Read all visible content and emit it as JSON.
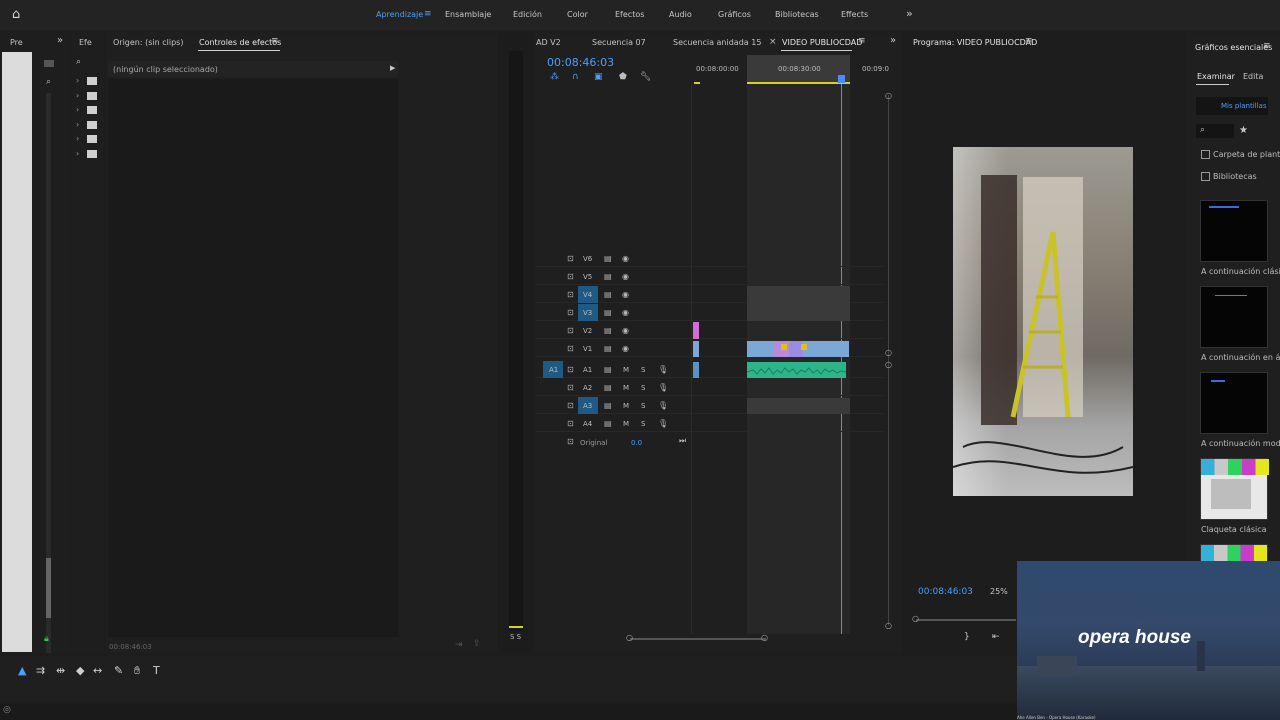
{
  "workspaces": [
    {
      "label": "Aprendizaje",
      "active": true
    },
    {
      "label": "Ensamblaje",
      "active": false
    },
    {
      "label": "Edición",
      "active": false
    },
    {
      "label": "Color",
      "active": false
    },
    {
      "label": "Efectos",
      "active": false
    },
    {
      "label": "Audio",
      "active": false
    },
    {
      "label": "Gráficos",
      "active": false
    },
    {
      "label": "Bibliotecas",
      "active": false
    },
    {
      "label": "Effects",
      "active": false
    }
  ],
  "panels": {
    "project_tab": "Pre",
    "effects_tab": "Efe",
    "source_tab": "Origen: (sin clips)",
    "effect_controls_tab": "Controles de efectos",
    "no_clip": "(ningún clip seleccionado)",
    "effect_controls_timecode": "00:08:46:03"
  },
  "timeline": {
    "tabs": [
      "AD V2",
      "Secuencia 07",
      "Secuencia anidada 15",
      "VIDEO PUBLIOCDAD"
    ],
    "active_tab": "VIDEO PUBLIOCDAD",
    "close_mark": "×",
    "timecode": "00:08:46:03",
    "ruler": [
      "00:08:00:00",
      "00:08:30:00",
      "00:09:0"
    ],
    "video_tracks": [
      "V6",
      "V5",
      "V4",
      "V3",
      "V2",
      "V1"
    ],
    "audio_tracks": [
      "A1",
      "A2",
      "A3",
      "A4"
    ],
    "source_patch": "A1",
    "mute": "M",
    "solo": "S",
    "original_label": "Original",
    "original_value": "0.0",
    "meter_label": "S S"
  },
  "program": {
    "title": "Programa: VIDEO PUBLIOCDAD",
    "timecode": "00:08:46:03",
    "zoom": "25%"
  },
  "essential_graphics": {
    "title": "Gráficos esenciales",
    "tabs": [
      "Examinar",
      "Edita"
    ],
    "templates_button": "Mis plantillas",
    "filters": [
      "Carpeta de plant",
      "Bibliotecas"
    ],
    "templates": [
      "A continuación clásic",
      "A continuación en án",
      "A continuación mode",
      "Claqueta clásica"
    ]
  },
  "overlay": {
    "title": "opera house",
    "caption": "Ahe Allen Ben - Opera House (Karaoke)"
  },
  "colors": {
    "accent": "#4a9fff",
    "track_highlight": "#1f5a85",
    "video_clip": "#7ba7d9",
    "audio_clip": "#2db58a",
    "playhead": "#4a8cff"
  }
}
